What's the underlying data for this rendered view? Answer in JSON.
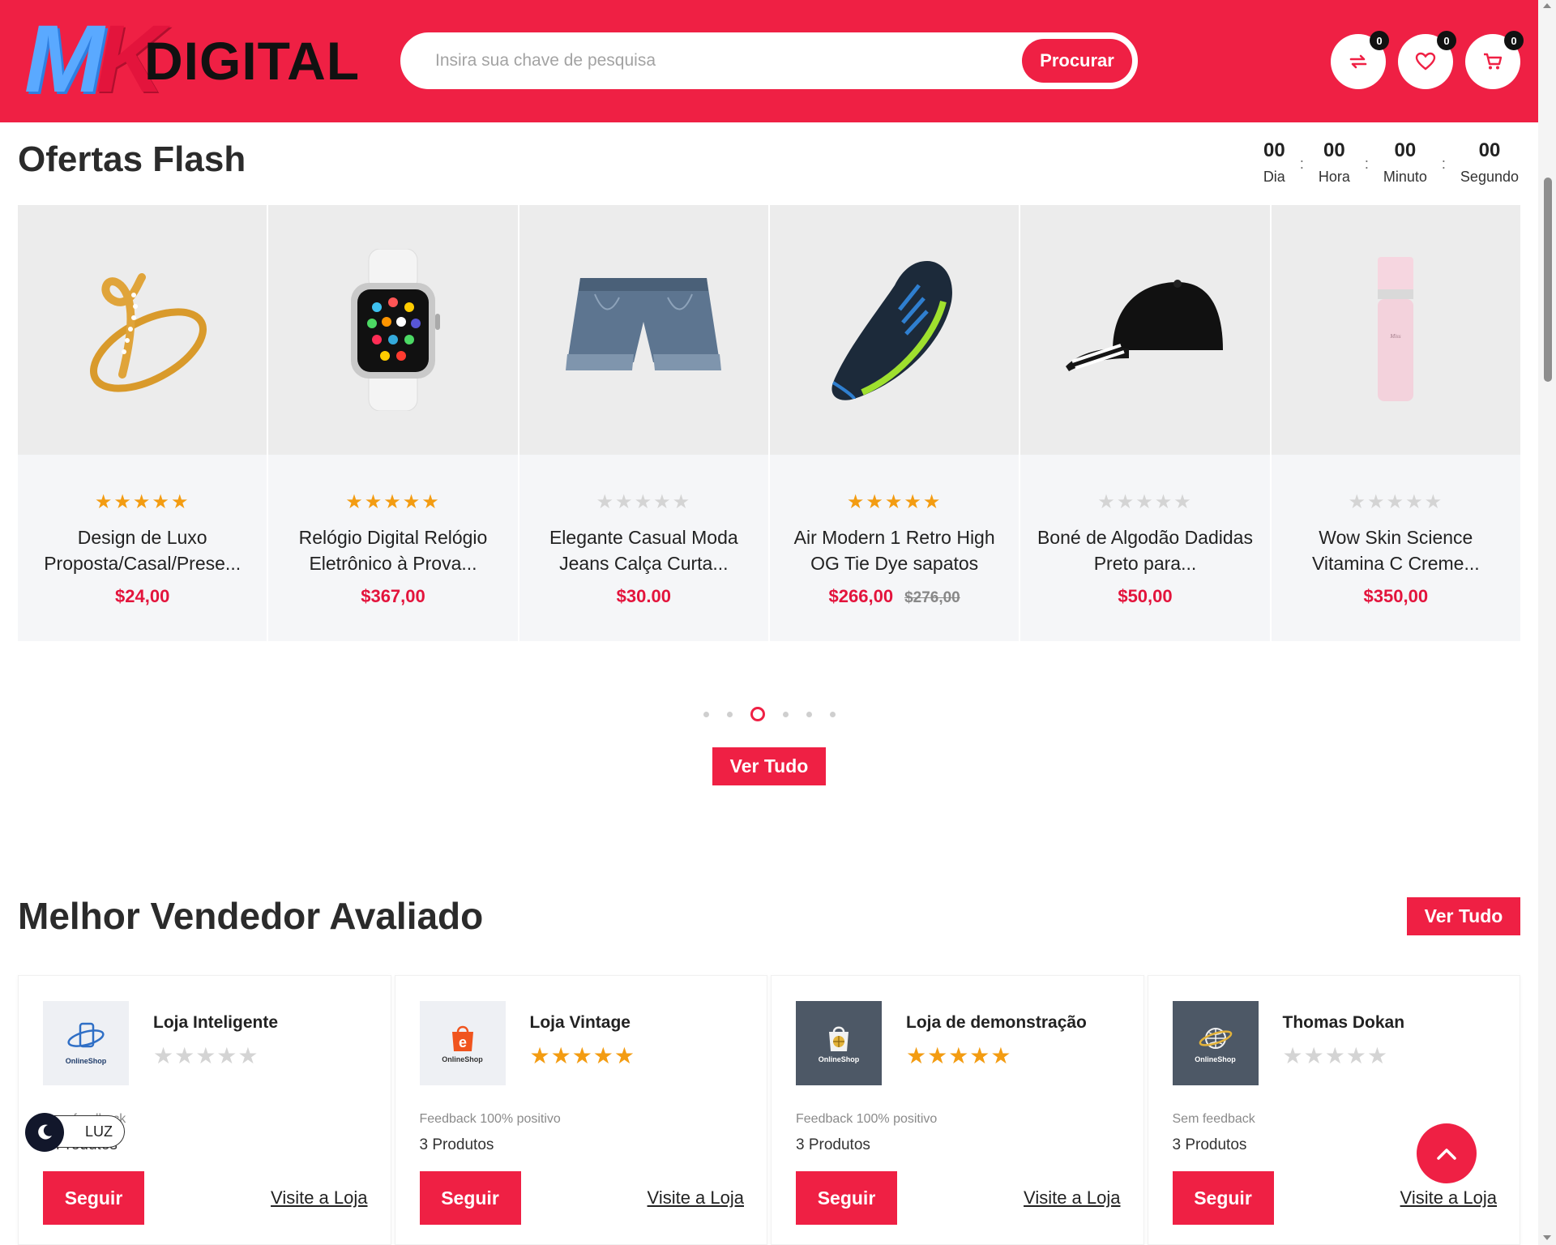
{
  "brand": {
    "logo_mk": "MK",
    "logo_text": "DIGITAL"
  },
  "search": {
    "placeholder": "Insira sua chave de pesquisa",
    "button_label": "Procurar"
  },
  "header_icons": [
    {
      "icon": "compare-icon",
      "count": "0"
    },
    {
      "icon": "heart-icon",
      "count": "0"
    },
    {
      "icon": "cart-icon",
      "count": "0"
    }
  ],
  "flash": {
    "title": "Ofertas Flash",
    "countdown": [
      {
        "value": "00",
        "label": "Dia"
      },
      {
        "value": "00",
        "label": "Hora"
      },
      {
        "value": "00",
        "label": "Minuto"
      },
      {
        "value": "00",
        "label": "Segundo"
      }
    ],
    "products": [
      {
        "name": "Design de Luxo Proposta/Casal/Prese...",
        "price": "$24,00",
        "old_price": "",
        "rating": 5,
        "image": "ring-image"
      },
      {
        "name": "Relógio Digital Relógio Eletrônico à Prova...",
        "price": "$367,00",
        "old_price": "",
        "rating": 5,
        "image": "smartwatch-image"
      },
      {
        "name": "Elegante Casual Moda Jeans Calça Curta...",
        "price": "$30.00",
        "old_price": "",
        "rating": 0,
        "image": "denim-shorts-image"
      },
      {
        "name": "Air Modern 1 Retro High OG Tie Dye sapatos",
        "price": "$266,00",
        "old_price": "$276,00",
        "rating": 5,
        "image": "sneaker-image"
      },
      {
        "name": "Boné de Algodão Dadidas Preto para...",
        "price": "$50,00",
        "old_price": "",
        "rating": 0,
        "image": "cap-image"
      },
      {
        "name": "Wow Skin Science Vitamina C Creme...",
        "price": "$350,00",
        "old_price": "",
        "rating": 0,
        "image": "cream-tube-image"
      }
    ],
    "pagination": {
      "count": 6,
      "active": 2
    },
    "view_all_label": "Ver Tudo"
  },
  "sellers": {
    "title": "Melhor Vendedor Avaliado",
    "view_all_label": "Ver Tudo",
    "items": [
      {
        "name": "Loja Inteligente",
        "rating": 0,
        "feedback": "Sem feedback",
        "products": "3 Produtos",
        "follow_label": "Seguir",
        "visit_label": "Visite a Loja",
        "logo_text": "OnlineShop",
        "logo_icon": "phone-icon"
      },
      {
        "name": "Loja Vintage",
        "rating": 5,
        "feedback": "Feedback 100% positivo",
        "products": "3 Produtos",
        "follow_label": "Seguir",
        "visit_label": "Visite a Loja",
        "logo_text": "OnlineShop",
        "logo_icon": "shopping-bag-icon"
      },
      {
        "name": "Loja de demonstração",
        "rating": 5,
        "feedback": "Feedback 100% positivo",
        "products": "3 Produtos",
        "follow_label": "Seguir",
        "visit_label": "Visite a Loja",
        "logo_text": "OnlineShop",
        "logo_icon": "bag-globe-icon"
      },
      {
        "name": "Thomas Dokan",
        "rating": 0,
        "feedback": "Sem feedback",
        "products": "3 Produtos",
        "follow_label": "Seguir",
        "visit_label": "Visite a Loja",
        "logo_text": "OnlineShop",
        "logo_icon": "globe-icon"
      }
    ]
  },
  "theme_toggle": {
    "label": "LUZ"
  },
  "colors": {
    "brand_red": "#ef2044",
    "price_red": "#e3143c",
    "star": "#f39c12"
  }
}
